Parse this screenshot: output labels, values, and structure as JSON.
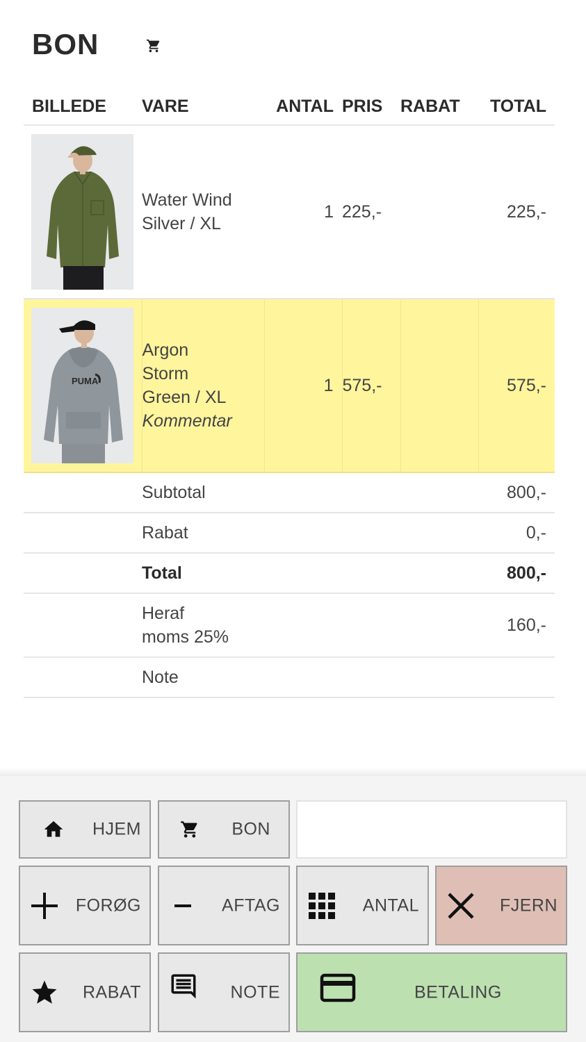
{
  "header": {
    "title": "BON",
    "cart_icon": "cart-icon"
  },
  "table": {
    "columns": [
      "BILLEDE",
      "VARE",
      "ANTAL",
      "PRIS",
      "RABAT",
      "TOTAL"
    ],
    "items": [
      {
        "image": "man-in-olive-shirt-and-cap",
        "name_line1": "Water Wind",
        "name_line2": "Silver / XL",
        "name_line3": "",
        "comment": "",
        "quantity": "1",
        "price": "225,-",
        "discount": "",
        "total": "225,-",
        "selected": false
      },
      {
        "image": "man-in-grey-hoodie-and-cap",
        "name_line1": "Argon",
        "name_line2": "Storm",
        "name_line3": "Green / XL",
        "comment": "Kommentar",
        "quantity": "1",
        "price": "575,-",
        "discount": "",
        "total": "575,-",
        "selected": true
      }
    ],
    "summary": {
      "subtotal_label": "Subtotal",
      "subtotal_value": "800,-",
      "discount_label": "Rabat",
      "discount_value": "0,-",
      "total_label": "Total",
      "total_value": "800,-",
      "vat_label_line1": "Heraf",
      "vat_label_line2": "moms 25%",
      "vat_value": "160,-",
      "note_label": "Note"
    }
  },
  "toolbar": {
    "home": {
      "label": "HJEM",
      "icon": "home-icon"
    },
    "receipt": {
      "label": "BON",
      "icon": "cart-icon"
    },
    "code_input": {
      "value": "",
      "placeholder": ""
    },
    "increase": {
      "label": "FORØG",
      "icon": "plus-icon"
    },
    "decrease": {
      "label": "AFTAG",
      "icon": "minus-icon"
    },
    "quantity": {
      "label": "ANTAL",
      "icon": "keypad-icon"
    },
    "remove": {
      "label": "FJERN",
      "icon": "close-icon"
    },
    "discount": {
      "label": "RABAT",
      "icon": "star-icon"
    },
    "note": {
      "label": "NOTE",
      "icon": "comment-icon"
    },
    "payment": {
      "label": "BETALING",
      "icon": "credit-card-icon"
    }
  },
  "colors": {
    "selected_row": "#fff59d",
    "remove_button": "#dfbfb5",
    "payment_button": "#bde0b1",
    "button": "#e8e8e8"
  }
}
